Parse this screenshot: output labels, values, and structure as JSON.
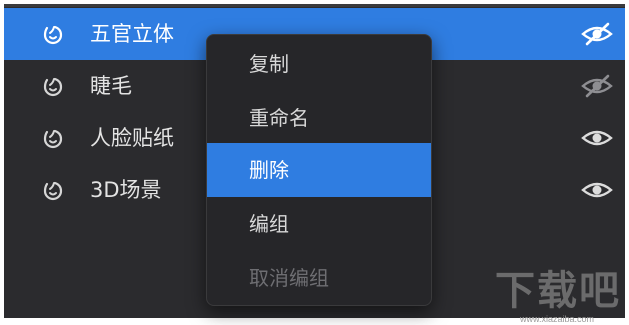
{
  "layers": [
    {
      "name": "五官立体",
      "selected": true,
      "visible": false,
      "icon": "face-icon"
    },
    {
      "name": "睫毛",
      "selected": false,
      "visible": false,
      "icon": "face-icon"
    },
    {
      "name": "人脸贴纸",
      "selected": false,
      "visible": true,
      "icon": "face-icon"
    },
    {
      "name": "3D场景",
      "selected": false,
      "visible": true,
      "icon": "face-icon"
    }
  ],
  "context_menu": {
    "items": [
      {
        "label": "复制",
        "state": "normal"
      },
      {
        "label": "重命名",
        "state": "normal"
      },
      {
        "label": "删除",
        "state": "highlighted"
      },
      {
        "label": "编组",
        "state": "normal"
      },
      {
        "label": "取消编组",
        "state": "disabled"
      }
    ]
  },
  "watermark": {
    "mark": "下载吧",
    "url": "www.xiazaiba.com"
  },
  "colors": {
    "accent": "#2f7de1",
    "panel": "#2b2b2e",
    "menu": "#262629"
  }
}
